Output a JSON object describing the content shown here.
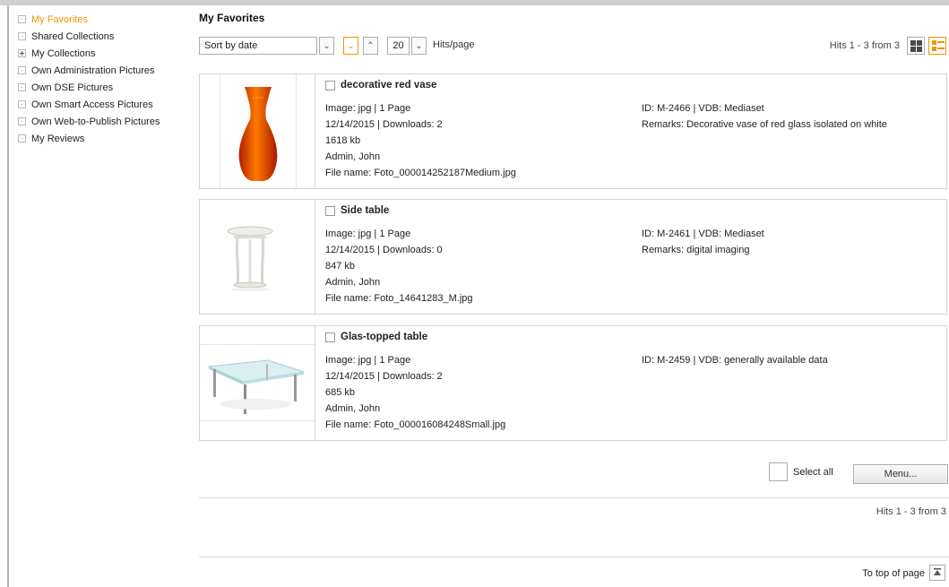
{
  "sidebar": {
    "items": [
      {
        "label": "My Favorites",
        "active": true,
        "expander": "dot"
      },
      {
        "label": "Shared Collections",
        "expander": "dot"
      },
      {
        "label": "My Collections",
        "expander": "plus"
      },
      {
        "label": "Own Administration Pictures",
        "expander": "dot"
      },
      {
        "label": "Own DSE Pictures",
        "expander": "dot"
      },
      {
        "label": "Own Smart Access Pictures",
        "expander": "dot"
      },
      {
        "label": "Own Web-to-Publish Pictures",
        "expander": "dot"
      },
      {
        "label": "My Reviews",
        "expander": "dot"
      }
    ]
  },
  "main": {
    "title": "My Favorites",
    "toolbar": {
      "sort_value": "Sort by date",
      "hits_per_page": "20",
      "hits_per_page_label": "Hits/page",
      "hits_info": "Hits 1 - 3 from 3"
    },
    "results": [
      {
        "title": "decorative red vase",
        "type_pages": "Image: jpg | 1 Page",
        "date_downloads": "12/14/2015 | Downloads: 2",
        "size": "1618 kb",
        "author": "Admin, John",
        "filename": "File name: Foto_000014252187Medium.jpg",
        "id_vdb": "ID: M-2466 | VDB: Mediaset",
        "remarks": "Remarks: Decorative vase of red glass isolated on white"
      },
      {
        "title": "Side table",
        "type_pages": "Image: jpg | 1 Page",
        "date_downloads": "12/14/2015 | Downloads: 0",
        "size": "847 kb",
        "author": "Admin, John",
        "filename": "File name: Foto_14641283_M.jpg",
        "id_vdb": "ID: M-2461 | VDB: Mediaset",
        "remarks": "Remarks: digital imaging"
      },
      {
        "title": "Glas-topped table",
        "type_pages": "Image: jpg | 1 Page",
        "date_downloads": "12/14/2015 | Downloads: 2",
        "size": "685 kb",
        "author": "Admin, John",
        "filename": "File name: Foto_000016084248Small.jpg",
        "id_vdb": "ID: M-2459 | VDB: generally available data",
        "remarks": ""
      }
    ],
    "footer": {
      "select_all_label": "Select all",
      "menu_label": "Menu...",
      "hits_info": "Hits 1 - 3 from 3",
      "to_top_label": "To top of page"
    }
  },
  "colors": {
    "accent": "#f29400",
    "border": "#d4d4d4"
  }
}
